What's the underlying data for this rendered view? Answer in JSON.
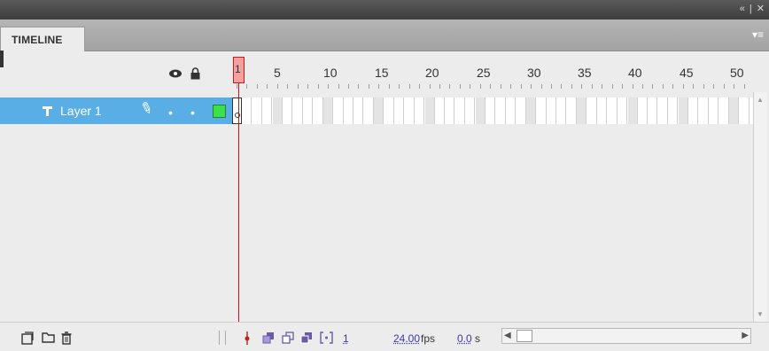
{
  "window": {
    "controls": "« | ✕"
  },
  "tabs": [
    {
      "label": "TIMELINE"
    }
  ],
  "panel_menu_icon": "▾≡",
  "header": {
    "show_hide_icon": "eye-icon",
    "lock_icon": "lock-icon",
    "outline_icon": "outline-icon"
  },
  "ruler": {
    "labels": [
      "1",
      "5",
      "10",
      "15",
      "20",
      "25",
      "30",
      "35",
      "40",
      "45",
      "50"
    ]
  },
  "playhead": {
    "frame": "1"
  },
  "layers": [
    {
      "name": "Layer 1",
      "color": "#3ce04a",
      "visible_dot": "•",
      "lock_dot": "•"
    }
  ],
  "statusbar": {
    "current_frame": "1",
    "frame_rate": "24.00",
    "frame_rate_unit": "fps",
    "elapsed_time": "0.0",
    "elapsed_time_unit": "s"
  },
  "colors": {
    "selection": "#5aaee6",
    "playhead": "#d20e0e",
    "layer_outline": "#3ce04a"
  }
}
